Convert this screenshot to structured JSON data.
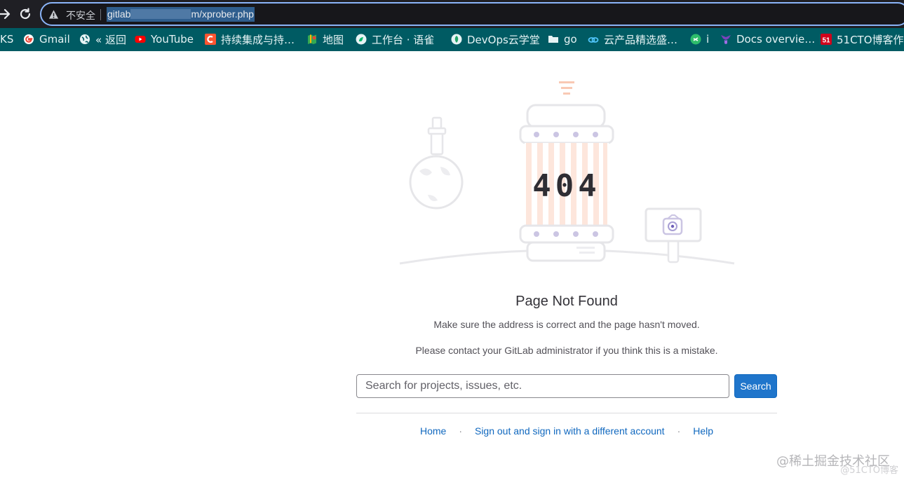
{
  "browser": {
    "insecure_label": "不安全",
    "url_prefix": "gitlab",
    "url_suffix": "m/xprober.php",
    "bookmarks": [
      {
        "label": "KS",
        "icon": "bookmark-folder-icon"
      },
      {
        "label": "Gmail",
        "icon": "google-icon"
      },
      {
        "label": "« 返回",
        "icon": "globe-icon"
      },
      {
        "label": "YouTube",
        "icon": "youtube-icon"
      },
      {
        "label": "持续集成与持…",
        "icon": "csdn-icon"
      },
      {
        "label": "地图",
        "icon": "maps-icon"
      },
      {
        "label": "工作台 · 语雀",
        "icon": "yuque-icon"
      },
      {
        "label": "DevOps云学堂",
        "icon": "devops-icon"
      },
      {
        "label": "go",
        "icon": "folder-icon"
      },
      {
        "label": "云产品精选盛…",
        "icon": "cloud-icon"
      },
      {
        "label": "i",
        "icon": "i-icon"
      },
      {
        "label": "Docs overvie…",
        "icon": "docs-icon"
      },
      {
        "label": "51CTO博客作…",
        "icon": "51cto-icon"
      }
    ]
  },
  "page": {
    "error_code": "404",
    "title": "Page Not Found",
    "message_1": "Make sure the address is correct and the page hasn't moved.",
    "message_2": "Please contact your GitLab administrator if you think this is a mistake.",
    "search_placeholder": "Search for projects, issues, etc.",
    "search_button": "Search",
    "footer_links": {
      "home": "Home",
      "sign_out": "Sign out and sign in with a different account",
      "help": "Help"
    },
    "separator": "·"
  },
  "watermark": {
    "main": "@稀土掘金技术社区",
    "sub": "@51CTO博客"
  },
  "colors": {
    "accent": "#1f75cb",
    "bookmark_bar": "#005b63",
    "link": "#1068bf"
  }
}
